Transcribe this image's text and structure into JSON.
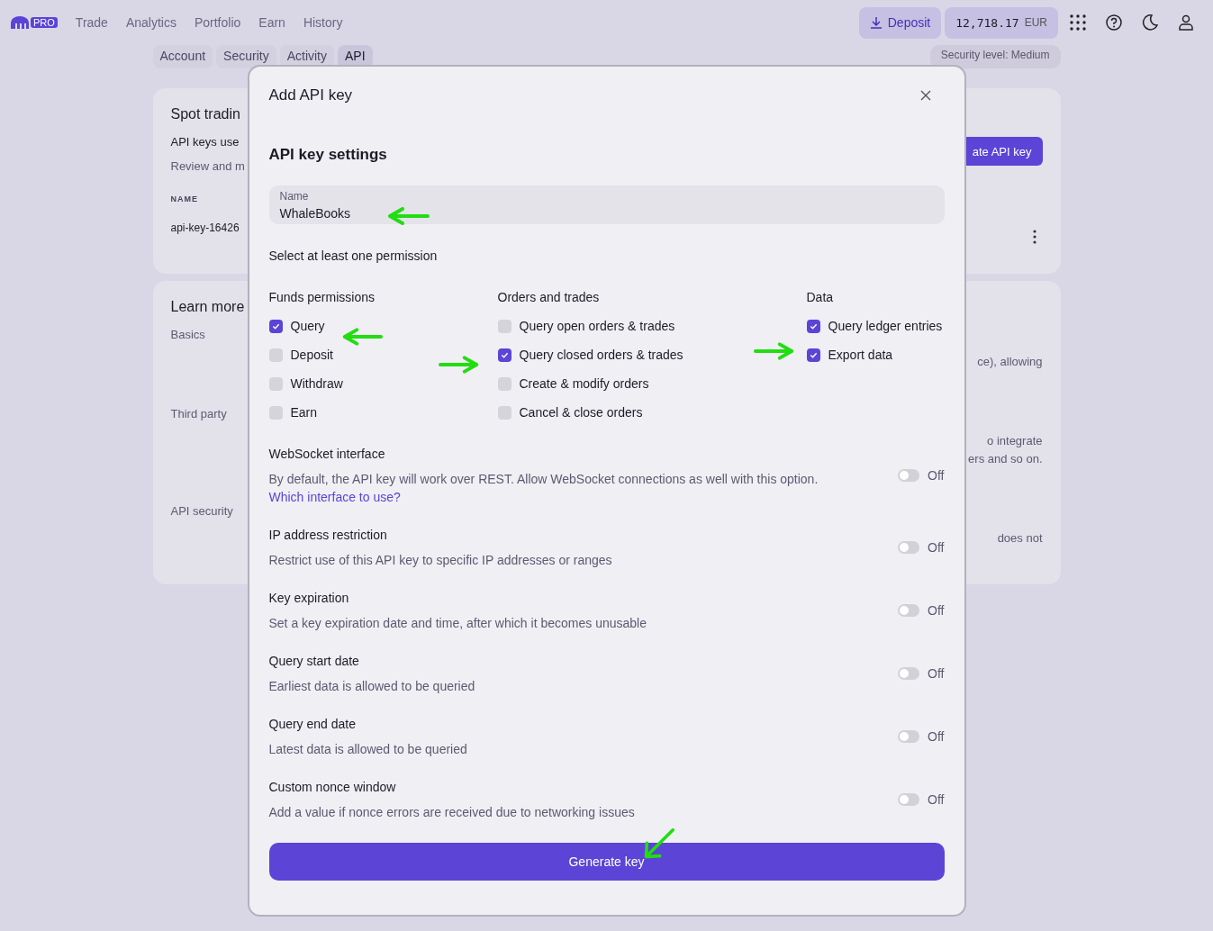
{
  "nav": {
    "logo_badge": "PRO",
    "links": [
      "Trade",
      "Analytics",
      "Portfolio",
      "Earn",
      "History"
    ],
    "deposit": "Deposit",
    "balance": "12,718.17",
    "currency": "EUR"
  },
  "subtabs": [
    {
      "label": "Account",
      "selected": false
    },
    {
      "label": "Security",
      "selected": false
    },
    {
      "label": "Activity",
      "selected": false
    },
    {
      "label": "API",
      "selected": true
    }
  ],
  "security_level": "Security level: Medium",
  "api_card": {
    "title": "Spot tradin",
    "subtitle": "API keys use",
    "description": "Review and m",
    "column_header": "NAME",
    "row_name": "api-key-16426",
    "create_button": "ate API key"
  },
  "learn_card": {
    "title": "Learn more",
    "sections": [
      {
        "label": "Basics",
        "text": [
          "ce), allowing"
        ]
      },
      {
        "label": "Third party",
        "text": [
          "o integrate",
          "ers and so on."
        ]
      },
      {
        "label": "API security",
        "text": [
          "does not"
        ]
      }
    ]
  },
  "modal": {
    "title": "Add API key",
    "heading": "API key settings",
    "name_field": {
      "label": "Name",
      "value": "WhaleBooks"
    },
    "permissions_hint": "Select at least one permission",
    "permission_groups": [
      {
        "title": "Funds permissions",
        "items": [
          {
            "label": "Query",
            "checked": true
          },
          {
            "label": "Deposit",
            "checked": false
          },
          {
            "label": "Withdraw",
            "checked": false
          },
          {
            "label": "Earn",
            "checked": false
          }
        ]
      },
      {
        "title": "Orders and trades",
        "items": [
          {
            "label": "Query open orders & trades",
            "checked": false
          },
          {
            "label": "Query closed orders & trades",
            "checked": true
          },
          {
            "label": "Create & modify orders",
            "checked": false
          },
          {
            "label": "Cancel & close orders",
            "checked": false
          }
        ]
      },
      {
        "title": "Data",
        "items": [
          {
            "label": "Query ledger entries",
            "checked": true
          },
          {
            "label": "Export data",
            "checked": true
          }
        ]
      }
    ],
    "options": [
      {
        "title": "WebSocket interface",
        "description": "By default, the API key will work over REST. Allow WebSocket connections as well with this option.",
        "link": "Which interface to use?",
        "on": false,
        "state_label": "Off"
      },
      {
        "title": "IP address restriction",
        "description": "Restrict use of this API key to specific IP addresses or ranges",
        "on": false,
        "state_label": "Off"
      },
      {
        "title": "Key expiration",
        "description": "Set a key expiration date and time, after which it becomes unusable",
        "on": false,
        "state_label": "Off"
      },
      {
        "title": "Query start date",
        "description": "Earliest data is allowed to be queried",
        "on": false,
        "state_label": "Off"
      },
      {
        "title": "Query end date",
        "description": "Latest data is allowed to be queried",
        "on": false,
        "state_label": "Off"
      },
      {
        "title": "Custom nonce window",
        "description": "Add a value if nonce errors are received due to networking issues",
        "on": false,
        "state_label": "Off"
      }
    ],
    "submit_button": "Generate key"
  }
}
